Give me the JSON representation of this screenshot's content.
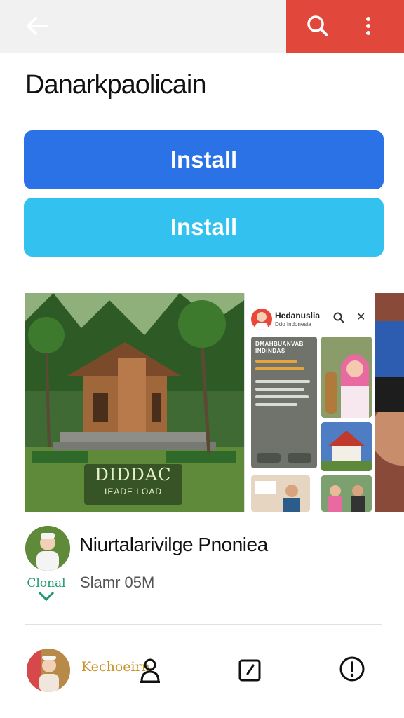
{
  "app": {
    "title": "Danarkpaolicain"
  },
  "toolbar": {
    "back_icon": "arrow-left-icon",
    "search_icon": "search-icon",
    "more_icon": "more-vertical-icon",
    "accent_color": "#e2473b"
  },
  "buttons": {
    "install_primary_label": "Install",
    "install_secondary_label": "Install",
    "primary_color": "#2b72e6",
    "secondary_color": "#33c2ef"
  },
  "gallery": {
    "main_caption_title": "DIDDAC",
    "main_caption_sub": "IEADE LOAD",
    "phone_title": "Hedanuslia",
    "phone_subtitle": "Ddo Indonesia",
    "phone_card_title": "DMAHBUANVAB\nINDINDAS"
  },
  "developer": {
    "name": "Niurtalarivilge Pnoniea",
    "brand_label": "Clonal",
    "meta": "Slamr 05M"
  },
  "bottom_bar": {
    "user_name": "Kechoeirn",
    "profile_icon": "person-icon",
    "edit_icon": "edit-square-icon",
    "info_icon": "alert-circle-icon"
  }
}
